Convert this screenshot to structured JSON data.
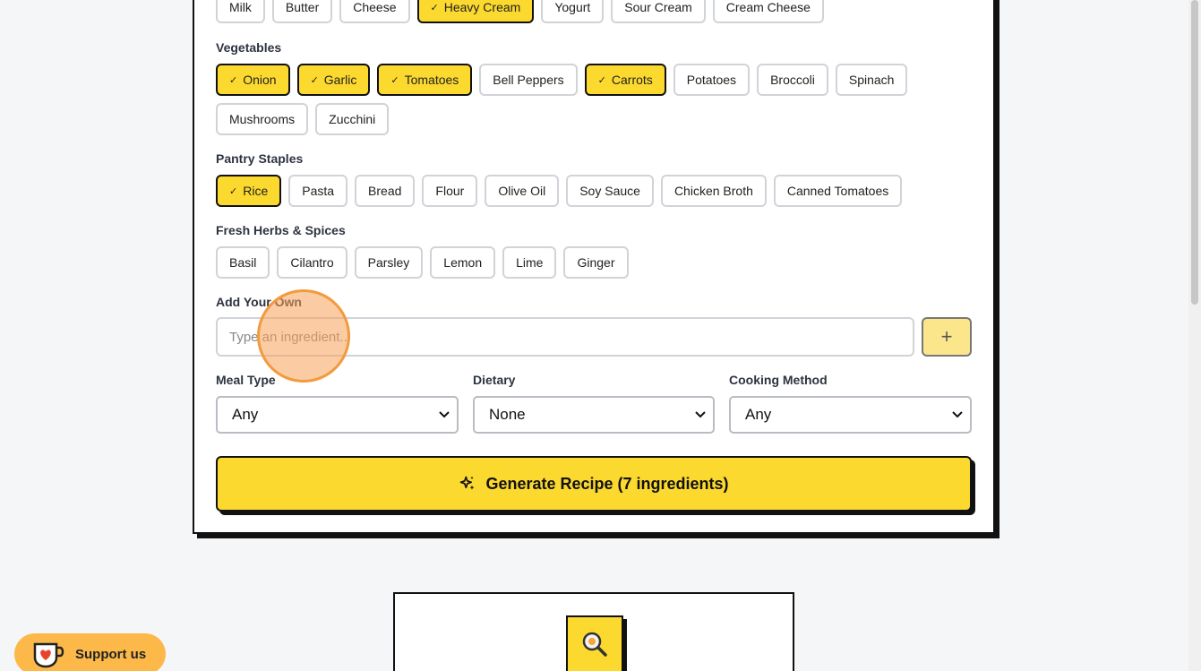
{
  "dairy": {
    "items": [
      {
        "label": "Milk",
        "selected": false
      },
      {
        "label": "Butter",
        "selected": false
      },
      {
        "label": "Cheese",
        "selected": false
      },
      {
        "label": "Heavy Cream",
        "selected": true
      },
      {
        "label": "Yogurt",
        "selected": false
      },
      {
        "label": "Sour Cream",
        "selected": false
      },
      {
        "label": "Cream Cheese",
        "selected": false
      }
    ]
  },
  "vegetables": {
    "title": "Vegetables",
    "items": [
      {
        "label": "Onion",
        "selected": true
      },
      {
        "label": "Garlic",
        "selected": true
      },
      {
        "label": "Tomatoes",
        "selected": true
      },
      {
        "label": "Bell Peppers",
        "selected": false
      },
      {
        "label": "Carrots",
        "selected": true
      },
      {
        "label": "Potatoes",
        "selected": false
      },
      {
        "label": "Broccoli",
        "selected": false
      },
      {
        "label": "Spinach",
        "selected": false
      },
      {
        "label": "Mushrooms",
        "selected": false
      },
      {
        "label": "Zucchini",
        "selected": false
      }
    ]
  },
  "pantry": {
    "title": "Pantry Staples",
    "items": [
      {
        "label": "Rice",
        "selected": true
      },
      {
        "label": "Pasta",
        "selected": false
      },
      {
        "label": "Bread",
        "selected": false
      },
      {
        "label": "Flour",
        "selected": false
      },
      {
        "label": "Olive Oil",
        "selected": false
      },
      {
        "label": "Soy Sauce",
        "selected": false
      },
      {
        "label": "Chicken Broth",
        "selected": false
      },
      {
        "label": "Canned Tomatoes",
        "selected": false
      }
    ]
  },
  "herbs": {
    "title": "Fresh Herbs & Spices",
    "items": [
      {
        "label": "Basil",
        "selected": false
      },
      {
        "label": "Cilantro",
        "selected": false
      },
      {
        "label": "Parsley",
        "selected": false
      },
      {
        "label": "Lemon",
        "selected": false
      },
      {
        "label": "Lime",
        "selected": false
      },
      {
        "label": "Ginger",
        "selected": false
      }
    ]
  },
  "custom": {
    "title": "Add Your Own",
    "placeholder": "Type an ingredient...",
    "add_icon": "plus-icon",
    "add_symbol": "+"
  },
  "filters": {
    "meal_type": {
      "label": "Meal Type",
      "value": "Any"
    },
    "dietary": {
      "label": "Dietary",
      "value": "None"
    },
    "cooking_method": {
      "label": "Cooking Method",
      "value": "Any"
    }
  },
  "generate": {
    "label": "Generate Recipe (7 ingredients)",
    "icon": "sparkles-icon"
  },
  "support": {
    "label": "Support us",
    "icon": "coffee-cup-heart-icon"
  },
  "colors": {
    "accent": "#fcd92e",
    "support": "#fcb94a",
    "border": "#111111"
  }
}
